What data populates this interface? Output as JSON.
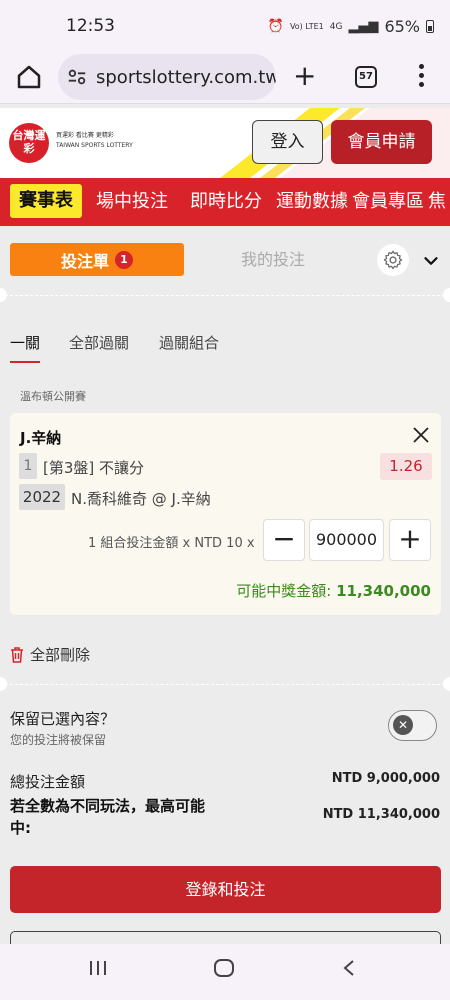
{
  "status_bar": {
    "time": "12:53",
    "network": "Vo) LTE1",
    "signal": "4G",
    "battery": "65%"
  },
  "browser": {
    "url": "sportslottery.com.tw",
    "tab_count": "57"
  },
  "site": {
    "logo_text": "台灣運彩",
    "logo_sub1": "買運彩 看比賽 更精彩",
    "logo_sub2": "TAIWAN SPORTS LOTTERY",
    "login_label": "登入",
    "register_label": "會員申請"
  },
  "nav": {
    "items": [
      {
        "label": "賽事表"
      },
      {
        "label": "場中投注"
      },
      {
        "label": "即時比分"
      },
      {
        "label": "運動數據"
      },
      {
        "label": "會員專區"
      },
      {
        "label": "焦"
      }
    ]
  },
  "betslip": {
    "tab_label": "投注單",
    "tab_count": "1",
    "mybets_label": "我的投注",
    "subtabs": [
      {
        "label": "一關"
      },
      {
        "label": "全部過關"
      },
      {
        "label": "過關組合"
      }
    ],
    "league": "溫布頓公開賽",
    "selection": {
      "player": "J.辛納",
      "leg_number": "1",
      "market": "[第3盤] 不讓分",
      "odds": "1.26",
      "game_code": "2022",
      "match": "N.喬科維奇 @ J.辛納",
      "stake_label": "1 組合投注金額 x NTD 10 x",
      "stake_value": "900000",
      "potential_win_label": "可能中獎金額:",
      "potential_win_value": "11,340,000"
    },
    "delete_all_label": "全部刪除",
    "keep_title": "保留已選內容？",
    "keep_subtitle": "您的投注將被保留",
    "keep_enabled": false,
    "total_label": "總投注金額",
    "total_value": "NTD 9,000,000",
    "max_win_label": "若全數為不同玩法，最高可能中:",
    "max_win_value": "NTD 11,340,000",
    "submit_label": "登錄和投注"
  },
  "colors": {
    "brand_red": "#d8232a",
    "nav_active": "#fde92b",
    "tab_orange": "#f98112",
    "win_green": "#3a8a1f",
    "odds_red": "#c0262d"
  }
}
